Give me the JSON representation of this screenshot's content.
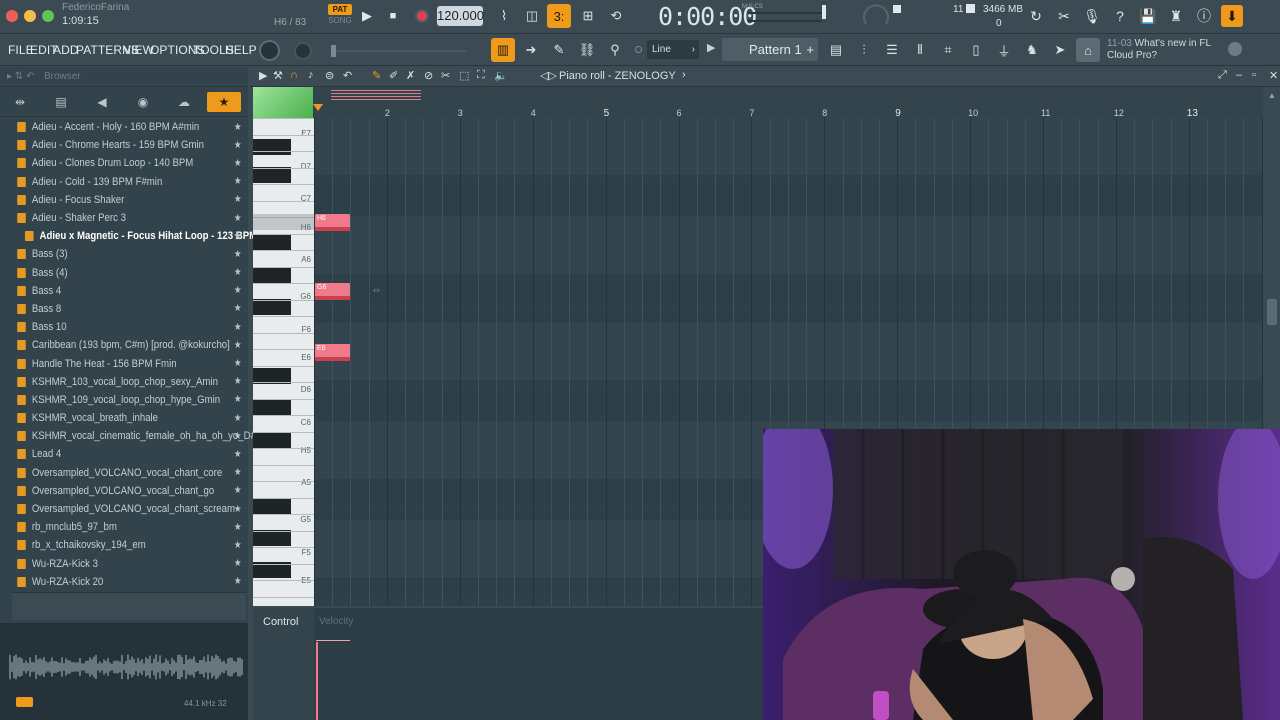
{
  "user": {
    "name": "FedericoFarina",
    "time": "1:09:15"
  },
  "hint_code": "H6 / 83",
  "pat_song": {
    "pat": "PAT",
    "song": "SONG"
  },
  "tempo": "120.000",
  "clock": {
    "time": "0:00:00",
    "label": "M:S:CS"
  },
  "cpu": {
    "voices": "11",
    "memory": "3466 MB",
    "zero": "0"
  },
  "menu": [
    "FILE",
    "EDIT",
    "ADD",
    "PATTERNS",
    "VIEW",
    "OPTIONS",
    "TOOLS",
    "HELP"
  ],
  "snap": {
    "label": "Line"
  },
  "pattern": {
    "label": "Pattern 1"
  },
  "news": {
    "code": "11-03",
    "title": "What's new in FL",
    "subtitle": "Cloud Pro?"
  },
  "browser": {
    "header": "Browser",
    "files": [
      "Adieu - Accent - Holy - 160 BPM A#min",
      "Adieu - Chrome Hearts - 159 BPM Gmin",
      "Adieu - Clones Drum Loop - 140 BPM",
      "Adieu - Cold - 139 BPM F#min",
      "Adieu - Focus Shaker",
      "Adieu - Shaker Perc 3",
      "Adieu x Magnetic - Focus Hihat Loop - 123 BPM",
      "Bass (3)",
      "Bass (4)",
      "Bass 4",
      "Bass 8",
      "Bass 10",
      "Caribbean (193 bpm, C#m) [prod. @kokurcho]",
      "Handle The Heat - 156 BPM Fmin",
      "KSHMR_103_vocal_loop_chop_sexy_Amin",
      "KSHMR_109_vocal_loop_chop_hype_Gmin",
      "KSHMR_vocal_breath_inhale",
      "KSHMR_vocal_cinematic_female_oh_ha_oh_yo_D#min",
      "Lead 4",
      "Oversampled_VOLCANO_vocal_chant_core",
      "Oversampled_VOLCANO_vocal_chant_go",
      "Oversampled_VOLCANO_vocal_chant_scream",
      "rb_mnclub5_97_bm",
      "rb_x_tchaikovsky_194_em",
      "Wu-RZA-Kick 3",
      "Wu-RZA-Kick 20"
    ],
    "selected_index": 6,
    "wave_info": "44.1 kHz 32"
  },
  "piano_roll": {
    "title": "Piano roll - ZENOLOGY",
    "bars": [
      "2",
      "3",
      "4",
      "5",
      "6",
      "7",
      "8",
      "9",
      "10",
      "11",
      "12",
      "13"
    ],
    "key_labels": [
      "E7",
      "D7",
      "C7",
      "H6",
      "A6",
      "G6",
      "F6",
      "E6",
      "D6",
      "C6",
      "H5",
      "A5",
      "G5",
      "F5",
      "E5"
    ],
    "notes": [
      "H6",
      "G6",
      "E6"
    ]
  },
  "control": {
    "label": "Control",
    "param": "Velocity"
  },
  "colors": {
    "accent": "#f09a1b",
    "note": "#f07a8a",
    "grid": "#30444e"
  }
}
